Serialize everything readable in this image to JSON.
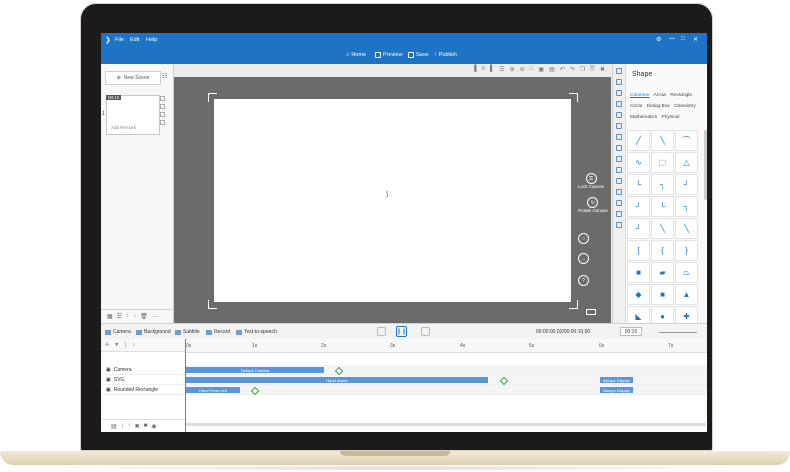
{
  "menu": {
    "items": [
      "File",
      "Edit",
      "Help"
    ]
  },
  "toolbar": {
    "home": "Home",
    "preview": "Preview",
    "save": "Save",
    "publish": "Publish"
  },
  "scenes": {
    "new_scene": "New Scene",
    "scene_time": "00:10",
    "scene_index": "1",
    "add_remark": "Add Remark"
  },
  "canvas": {
    "lock_label": "Lock Canvas",
    "rotate_label": "Rotate Canvas"
  },
  "shape_panel": {
    "title": "Shape",
    "tabs": [
      "Common",
      "Arrow",
      "Rectangle",
      "Circle",
      "Dialog Box",
      "Chemistry",
      "Mathematics",
      "Physical"
    ],
    "active_tab": "Common"
  },
  "midbar": {
    "camera": "Camera",
    "background": "Background",
    "subtitle": "Subtitle",
    "record": "Record",
    "tts": "Text-to-speech",
    "timecode": "00:00:00.02/00:00:10.00",
    "duration": "00:10"
  },
  "timeline": {
    "ticks": [
      "0s",
      "1s",
      "2s",
      "3s",
      "4s",
      "5s",
      "6s",
      "7s"
    ],
    "tracks": [
      {
        "name": "Camera",
        "bar": "Default Camera"
      },
      {
        "name": "SVG",
        "bar": "Hand drawn",
        "badge": "Always Display"
      },
      {
        "name": "Rounded Rectangle",
        "bar": "Hand From Left",
        "badge": "Always Display"
      }
    ]
  },
  "colors": {
    "accent": "#1e73c5",
    "stage": "#6b6b6b",
    "track": "#5b97d8",
    "keyframe": "#2fa34a"
  }
}
